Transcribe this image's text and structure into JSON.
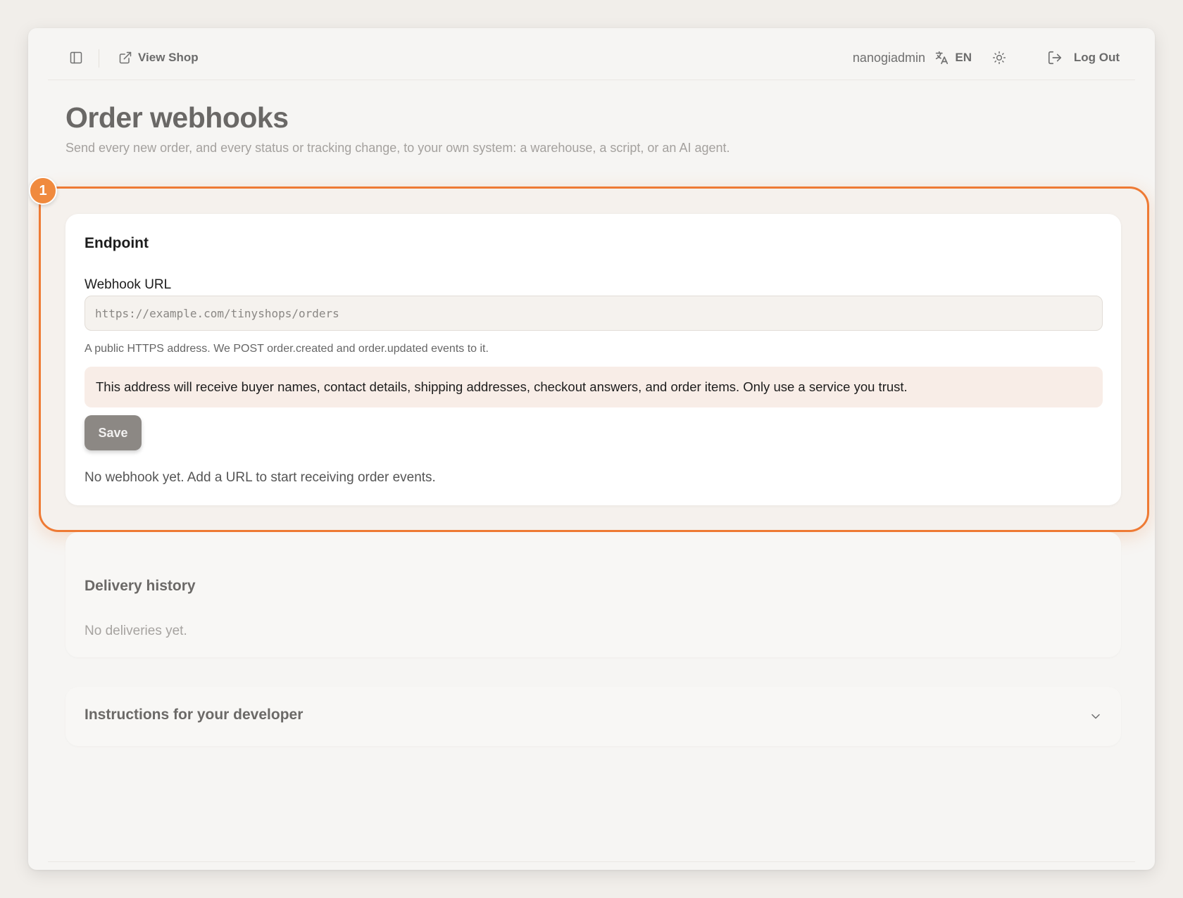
{
  "topbar": {
    "view_shop_label": "View Shop",
    "username": "nanogiadmin",
    "language": "EN",
    "logout_label": "Log Out"
  },
  "header": {
    "title": "Order webhooks",
    "description": "Send every new order, and every status or tracking change, to your own system: a warehouse, a script, or an AI agent."
  },
  "highlight": {
    "badge": "1",
    "color": "#ee7a34"
  },
  "endpoint": {
    "title": "Endpoint",
    "url_label": "Webhook URL",
    "url_value": "",
    "url_placeholder": "https://example.com/tinyshops/orders",
    "help_text": "A public HTTPS address. We POST order.created and order.updated events to it.",
    "warning_text": "This address will receive buyer names, contact details, shipping addresses, checkout answers, and order items. Only use a service you trust.",
    "save_label": "Save",
    "empty_text": "No webhook yet. Add a URL to start receiving order events."
  },
  "delivery": {
    "title": "Delivery history",
    "empty_text": "No deliveries yet."
  },
  "instructions": {
    "title": "Instructions for your developer"
  }
}
